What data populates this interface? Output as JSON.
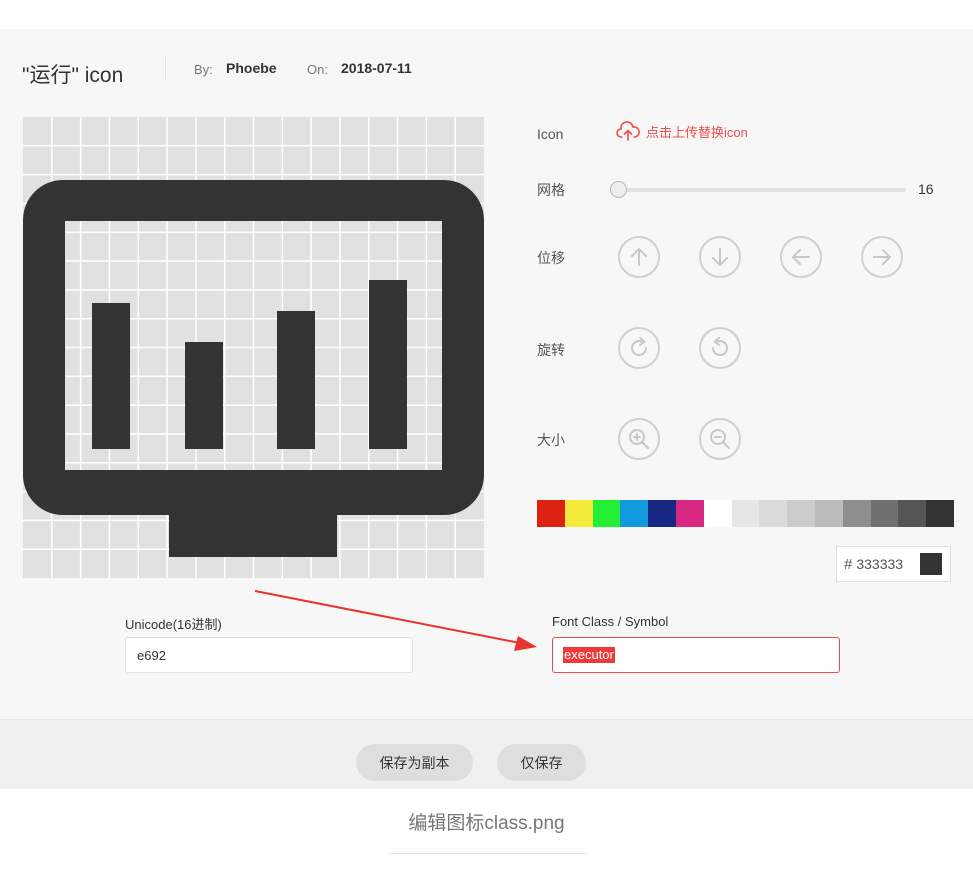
{
  "header": {
    "title": "\"运行\" icon",
    "by_label": "By:",
    "author": "Phoebe",
    "on_label": "On:",
    "date": "2018-07-11"
  },
  "controls": {
    "icon_label": "Icon",
    "upload_text": "点击上传替换icon",
    "grid_label": "网格",
    "grid_value": "16",
    "move_label": "位移",
    "rotate_label": "旋转",
    "size_label": "大小",
    "move_buttons": [
      "arrow-up",
      "arrow-down",
      "arrow-left",
      "arrow-right"
    ],
    "rotate_buttons": [
      "rotate-clockwise",
      "rotate-counterclockwise"
    ],
    "size_buttons": [
      "zoom-in",
      "zoom-out"
    ]
  },
  "palette": [
    "#dd2211",
    "#f5e93a",
    "#22ee33",
    "#1199dd",
    "#172883",
    "#d82781",
    "#ffffff",
    "#e6e6e6",
    "#dbdbdb",
    "#cccccc",
    "#bbbbbb",
    "#8e8e8e",
    "#707070",
    "#555555",
    "#333333"
  ],
  "color": {
    "hash": "#",
    "value": "333333",
    "hex": "#333333"
  },
  "fields": {
    "unicode_label": "Unicode(16进制)",
    "unicode_value": "e692",
    "fontclass_label": "Font Class / Symbol",
    "fontclass_value": "executor"
  },
  "buttons": {
    "save_copy": "保存为副本",
    "save_only": "仅保存"
  },
  "caption": "编辑图标class.png",
  "icon_name": "monitor-bar-chart-icon"
}
